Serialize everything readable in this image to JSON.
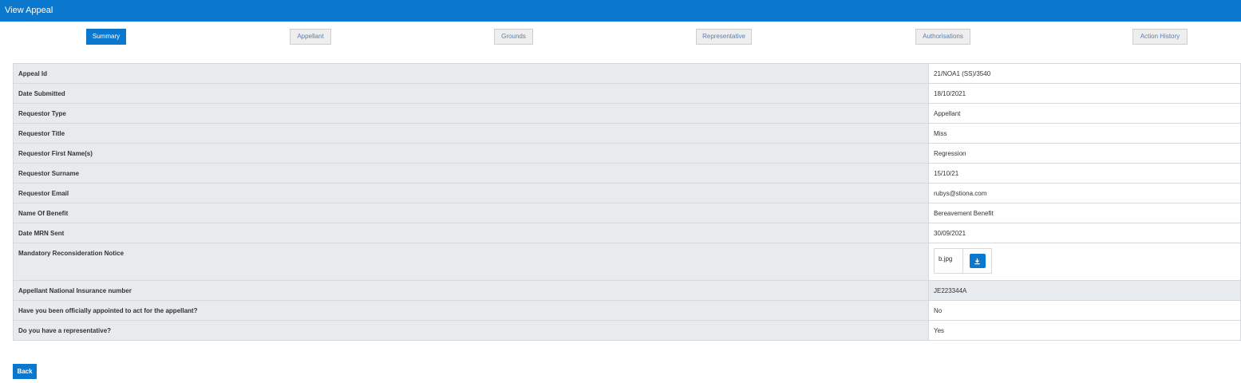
{
  "header": {
    "title": "View Appeal"
  },
  "tabs": [
    {
      "label": "Summary",
      "active": true
    },
    {
      "label": "Appellant",
      "active": false
    },
    {
      "label": "Grounds",
      "active": false
    },
    {
      "label": "Representative",
      "active": false
    },
    {
      "label": "Authorisations",
      "active": false
    },
    {
      "label": "Action History",
      "active": false
    }
  ],
  "rows": [
    {
      "label": "Appeal Id",
      "value": "21/NOA1 (SS)/3540"
    },
    {
      "label": "Date Submitted",
      "value": "18/10/2021"
    },
    {
      "label": "Requestor Type",
      "value": "Appellant"
    },
    {
      "label": "Requestor Title",
      "value": "Miss"
    },
    {
      "label": "Requestor First Name(s)",
      "value": "Regression"
    },
    {
      "label": "Requestor Surname",
      "value": "15/10/21"
    },
    {
      "label": "Requestor Email",
      "value": "rubys@stiona.com"
    },
    {
      "label": "Name Of Benefit",
      "value": "Bereavement Benefit"
    },
    {
      "label": "Date MRN Sent",
      "value": "30/09/2021"
    },
    {
      "label": "Mandatory Reconsideration Notice",
      "file_name": "b.jpg",
      "icon": "download-icon"
    },
    {
      "label": "Appellant National Insurance number",
      "value": "JE223344A"
    },
    {
      "label": "Have you been officially appointed to act for the appellant?",
      "value": "No"
    },
    {
      "label": "Do you have a representative?",
      "value": "Yes"
    }
  ],
  "back_label": "Back",
  "colors": {
    "accent": "#0b78d0",
    "label_bg": "#e8ebee",
    "border": "#d6d9dc"
  }
}
